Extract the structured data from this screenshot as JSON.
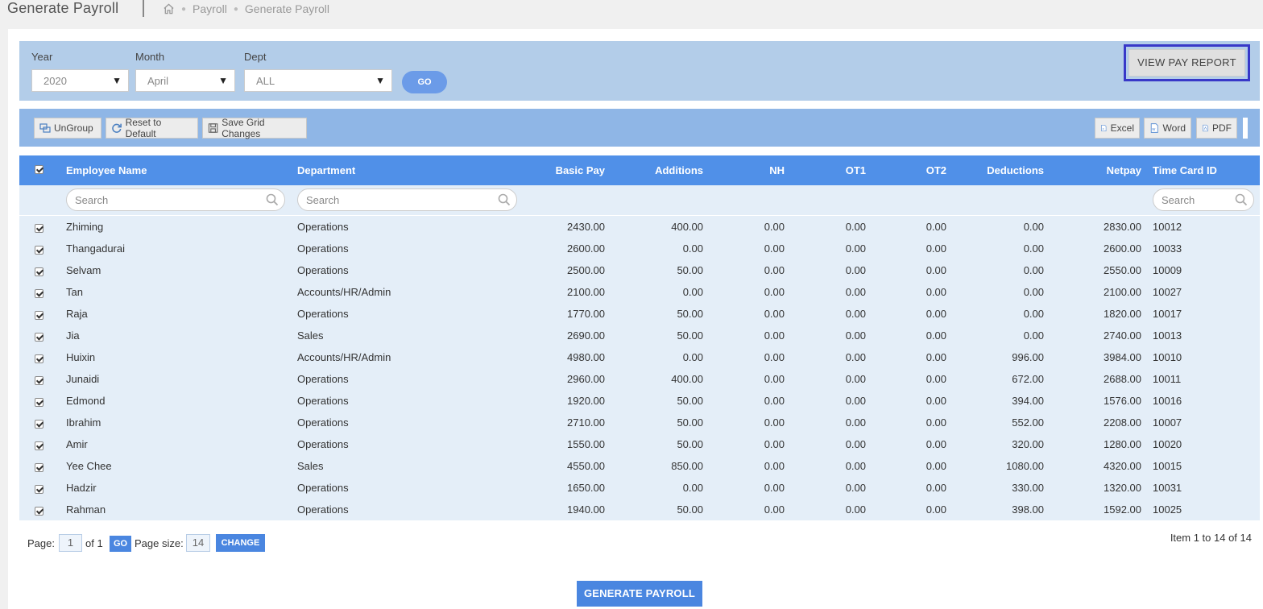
{
  "page": {
    "title": "Generate Payroll",
    "breadcrumb": [
      "Payroll",
      "Generate Payroll"
    ]
  },
  "filters": {
    "year_label": "Year",
    "year_value": "2020",
    "month_label": "Month",
    "month_value": "April",
    "dept_label": "Dept",
    "dept_value": "ALL",
    "go_label": "GO",
    "view_report_label": "VIEW PAY REPORT"
  },
  "toolbar": {
    "ungroup": "UnGroup",
    "reset": "Reset to Default",
    "save": "Save Grid Changes",
    "excel": "Excel",
    "word": "Word",
    "pdf": "PDF"
  },
  "grid": {
    "columns": [
      "Employee Name",
      "Department",
      "Basic Pay",
      "Additions",
      "NH",
      "OT1",
      "OT2",
      "Deductions",
      "Netpay",
      "Time Card ID"
    ],
    "search_placeholder": "Search",
    "rows": [
      [
        "Zhiming",
        "Operations",
        "2430.00",
        "400.00",
        "0.00",
        "0.00",
        "0.00",
        "0.00",
        "2830.00",
        "10012"
      ],
      [
        "Thangadurai",
        "Operations",
        "2600.00",
        "0.00",
        "0.00",
        "0.00",
        "0.00",
        "0.00",
        "2600.00",
        "10033"
      ],
      [
        "Selvam",
        "Operations",
        "2500.00",
        "50.00",
        "0.00",
        "0.00",
        "0.00",
        "0.00",
        "2550.00",
        "10009"
      ],
      [
        "Tan",
        "Accounts/HR/Admin",
        "2100.00",
        "0.00",
        "0.00",
        "0.00",
        "0.00",
        "0.00",
        "2100.00",
        "10027"
      ],
      [
        "Raja",
        "Operations",
        "1770.00",
        "50.00",
        "0.00",
        "0.00",
        "0.00",
        "0.00",
        "1820.00",
        "10017"
      ],
      [
        "Jia",
        "Sales",
        "2690.00",
        "50.00",
        "0.00",
        "0.00",
        "0.00",
        "0.00",
        "2740.00",
        "10013"
      ],
      [
        "Huixin",
        "Accounts/HR/Admin",
        "4980.00",
        "0.00",
        "0.00",
        "0.00",
        "0.00",
        "996.00",
        "3984.00",
        "10010"
      ],
      [
        "Junaidi",
        "Operations",
        "2960.00",
        "400.00",
        "0.00",
        "0.00",
        "0.00",
        "672.00",
        "2688.00",
        "10011"
      ],
      [
        "Edmond",
        "Operations",
        "1920.00",
        "50.00",
        "0.00",
        "0.00",
        "0.00",
        "394.00",
        "1576.00",
        "10016"
      ],
      [
        "Ibrahim",
        "Operations",
        "2710.00",
        "50.00",
        "0.00",
        "0.00",
        "0.00",
        "552.00",
        "2208.00",
        "10007"
      ],
      [
        "Amir",
        "Operations",
        "1550.00",
        "50.00",
        "0.00",
        "0.00",
        "0.00",
        "320.00",
        "1280.00",
        "10020"
      ],
      [
        "Yee Chee",
        "Sales",
        "4550.00",
        "850.00",
        "0.00",
        "0.00",
        "0.00",
        "1080.00",
        "4320.00",
        "10015"
      ],
      [
        "Hadzir",
        "Operations",
        "1650.00",
        "0.00",
        "0.00",
        "0.00",
        "0.00",
        "330.00",
        "1320.00",
        "10031"
      ],
      [
        "Rahman",
        "Operations",
        "1940.00",
        "50.00",
        "0.00",
        "0.00",
        "0.00",
        "398.00",
        "1592.00",
        "10025"
      ]
    ]
  },
  "pager": {
    "page_label": "Page:",
    "page_value": "1",
    "of_label": "of 1",
    "go_label": "GO",
    "size_label": "Page size:",
    "size_value": "14",
    "change_label": "CHANGE",
    "items_info": "Item 1 to 14 of 14"
  },
  "actions": {
    "generate_label": "GENERATE PAYROLL"
  }
}
